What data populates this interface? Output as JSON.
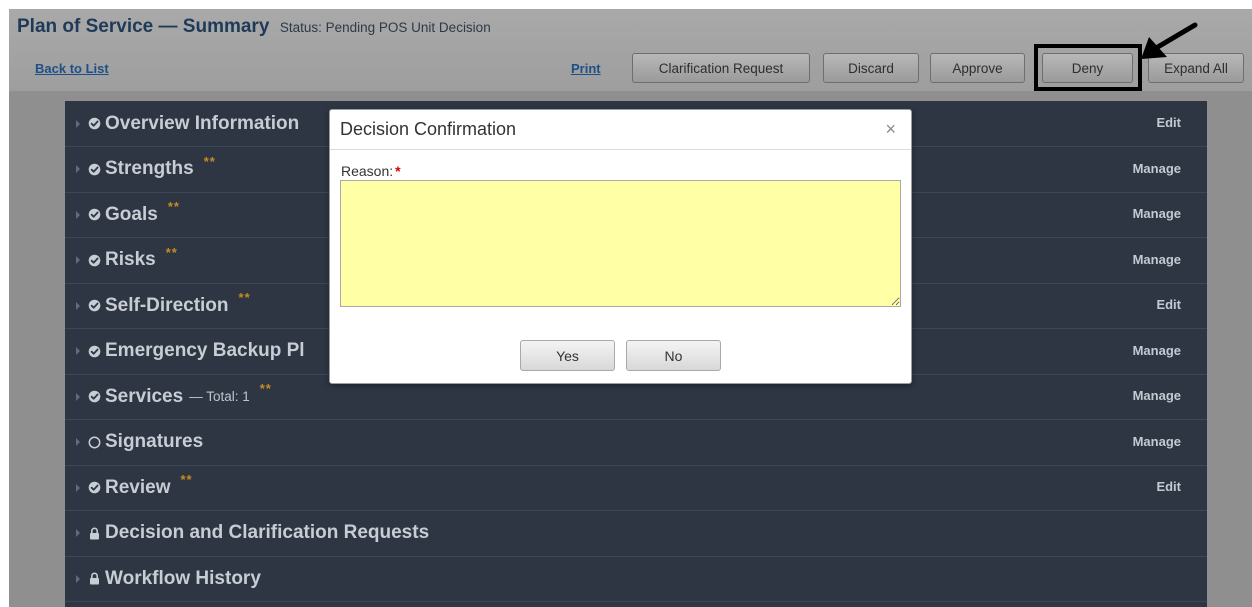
{
  "header": {
    "title": "Plan of Service — Summary",
    "status": "Status: Pending POS Unit Decision"
  },
  "toolbar": {
    "back_label": "Back to List",
    "print_label": "Print",
    "clarification_label": "Clarification Request",
    "discard_label": "Discard",
    "approve_label": "Approve",
    "deny_label": "Deny",
    "expand_label": "Expand All"
  },
  "sections": [
    {
      "title": "Overview Information",
      "icon": "check-circle-icon",
      "stars": "",
      "subtitle": "",
      "action": "Edit"
    },
    {
      "title": "Strengths",
      "icon": "check-circle-icon",
      "stars": "**",
      "subtitle": "",
      "action": "Manage"
    },
    {
      "title": "Goals",
      "icon": "check-circle-icon",
      "stars": "**",
      "subtitle": "",
      "action": "Manage"
    },
    {
      "title": "Risks",
      "icon": "check-circle-icon",
      "stars": "**",
      "subtitle": "",
      "action": "Manage"
    },
    {
      "title": "Self-Direction",
      "icon": "check-circle-icon",
      "stars": "**",
      "subtitle": "",
      "action": "Edit"
    },
    {
      "title": "Emergency Backup Pl",
      "icon": "check-circle-icon",
      "stars": "",
      "subtitle": "",
      "action": "Manage"
    },
    {
      "title": "Services",
      "icon": "check-circle-icon",
      "stars": "**",
      "subtitle": "— Total: 1",
      "action": "Manage"
    },
    {
      "title": "Signatures",
      "icon": "empty-circle-icon",
      "stars": "",
      "subtitle": "",
      "action": "Manage"
    },
    {
      "title": "Review",
      "icon": "check-circle-icon",
      "stars": "**",
      "subtitle": "",
      "action": "Edit"
    },
    {
      "title": "Decision and Clarification Requests",
      "icon": "lock-icon",
      "stars": "",
      "subtitle": "",
      "action": ""
    },
    {
      "title": "Workflow History",
      "icon": "lock-icon",
      "stars": "",
      "subtitle": "",
      "action": ""
    }
  ],
  "modal": {
    "title": "Decision Confirmation",
    "close_label": "×",
    "reason_label": "Reason:",
    "required_mark": "*",
    "reason_value": "",
    "yes_label": "Yes",
    "no_label": "No"
  },
  "colors": {
    "panel": "#2e3644",
    "title": "#1e3a58",
    "stars": "#c88a22",
    "textarea": "#ffffa6",
    "highlight_box": "#000000"
  }
}
